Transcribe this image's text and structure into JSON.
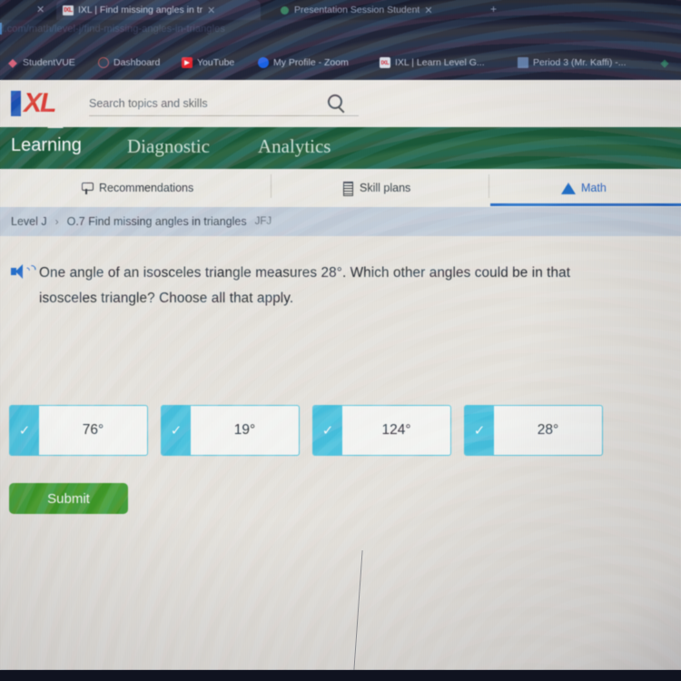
{
  "browser": {
    "tabs": [
      {
        "title": "IXL | Find missing angles in tr",
        "favicon": "ixl-favicon",
        "active": true,
        "close_label": "✕"
      },
      {
        "title": "Presentation Session Student",
        "favicon": "session-favicon",
        "active": false,
        "close_label": "✕"
      }
    ],
    "tab_close_left_label": "✕",
    "new_tab_label": "+",
    "url": "l.com/math/level-j/find-missing-angles-in-triangles",
    "bookmarks": [
      {
        "label": "StudentVUE",
        "icon": "studentvue-icon"
      },
      {
        "label": "Dashboard",
        "icon": "dashboard-icon"
      },
      {
        "label": "YouTube",
        "icon": "youtube-icon"
      },
      {
        "label": "My Profile - Zoom",
        "icon": "zoom-icon"
      },
      {
        "label": "IXL | Learn Level G...",
        "icon": "ixl-icon"
      },
      {
        "label": "Period 3 (Mr. Kaffi) -...",
        "icon": "document-icon"
      }
    ]
  },
  "ixl": {
    "logo_text": "XL",
    "search": {
      "placeholder": "Search topics and skills",
      "value": ""
    },
    "main_nav": [
      {
        "label": "Learning",
        "active": true
      },
      {
        "label": "Diagnostic",
        "active": false
      },
      {
        "label": "Analytics",
        "active": false
      }
    ],
    "sub_nav": [
      {
        "label": "Recommendations",
        "icon": "recommendations-icon",
        "active": false
      },
      {
        "label": "Skill plans",
        "icon": "skill-plans-icon",
        "active": false
      },
      {
        "label": "Math",
        "icon": "math-pyramid-icon",
        "active": true
      }
    ],
    "breadcrumb": {
      "level": "Level J",
      "separator": "›",
      "skill": "O.7 Find missing angles in triangles",
      "code": "JFJ"
    },
    "question": {
      "audio_icon": "speaker-icon",
      "line1": "One angle of an isosceles triangle measures 28°. Which other angles could be in that",
      "line2": "isosceles triangle? Choose all that apply."
    },
    "choices": [
      {
        "label": "76°",
        "checked": true,
        "check_glyph": "✓"
      },
      {
        "label": "19°",
        "checked": true,
        "check_glyph": "✓"
      },
      {
        "label": "124°",
        "checked": true,
        "check_glyph": "✓"
      },
      {
        "label": "28°",
        "checked": true,
        "check_glyph": "✓"
      }
    ],
    "submit_label": "Submit"
  },
  "colors": {
    "ixl_green": "#1b5b3a",
    "ixl_red": "#e03127",
    "ixl_blue": "#1b52b8",
    "choice_teal": "#46c2e0",
    "submit_green": "#3f9b28",
    "active_tab_blue": "#1f63c4",
    "breadcrumb_bg": "#c3cdda"
  }
}
